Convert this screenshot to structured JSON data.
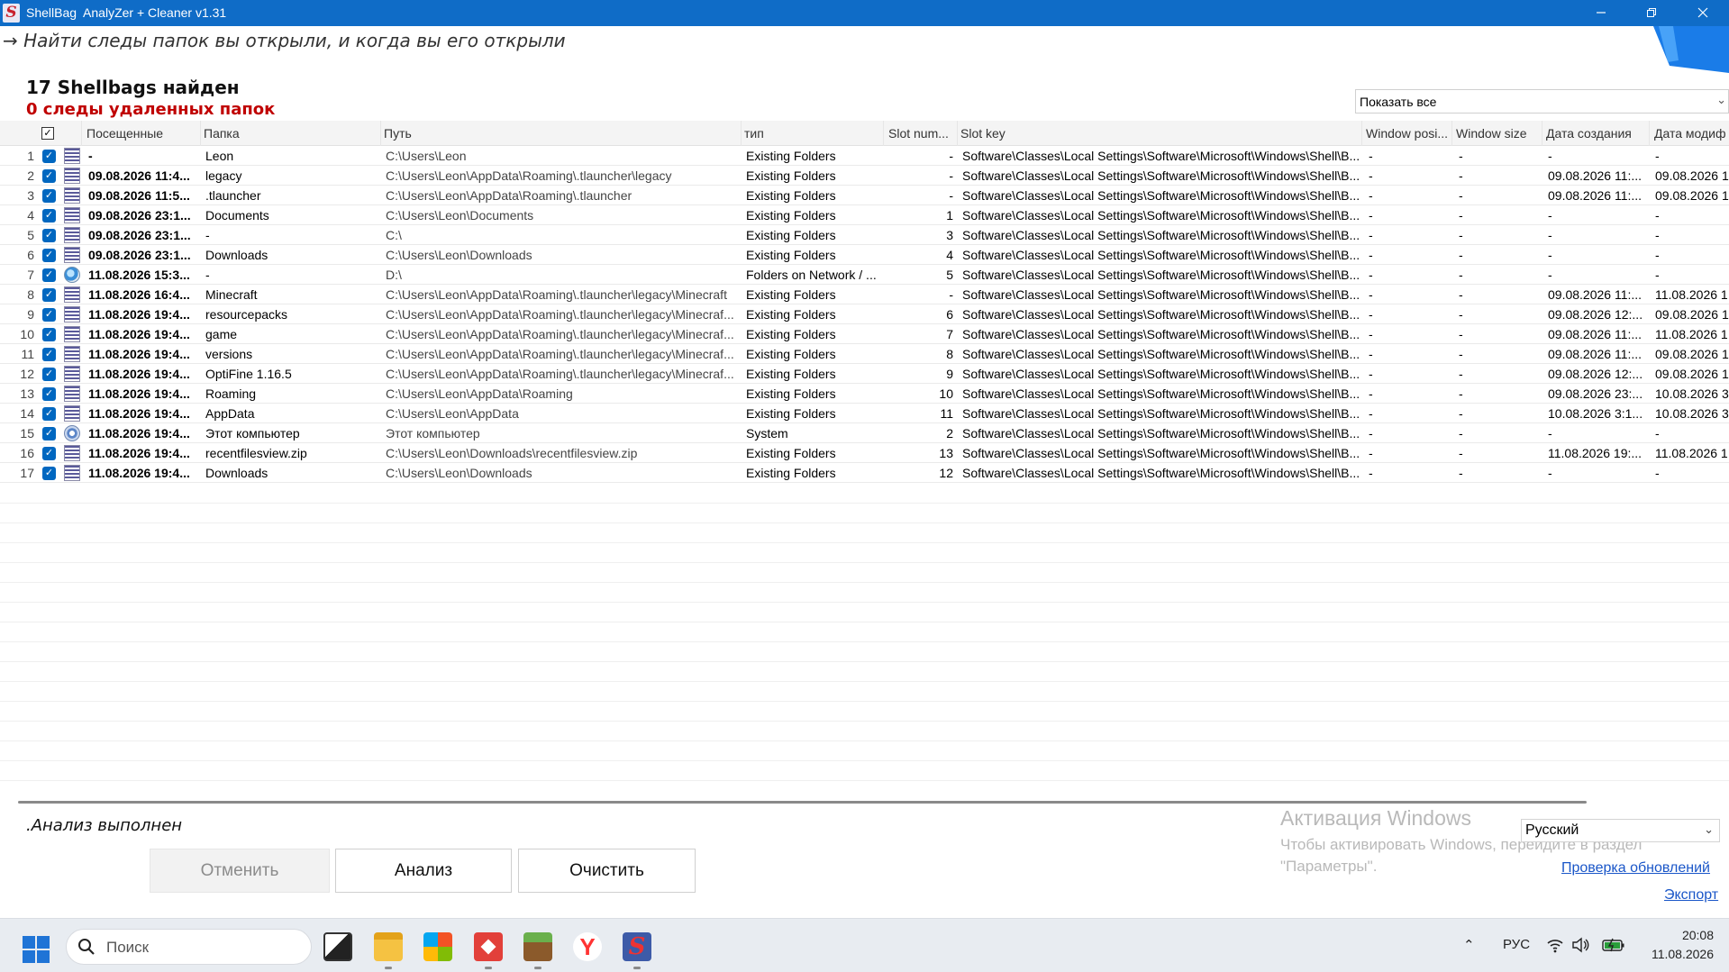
{
  "window": {
    "title": "ShellBag  AnalyZer + Cleaner v1.31",
    "icon_letter": "S",
    "minimize_icon": "minimize-icon",
    "maximize_icon": "restore-icon",
    "close_icon": "close-icon"
  },
  "tagline": "→ Найти следы папок вы открыли, и когда вы его открыли",
  "summary": {
    "found": "17 Shellbags найден",
    "deleted": "0  следы удаленных папок"
  },
  "filter": {
    "value": "Показать все"
  },
  "table": {
    "columns": [
      "Посещенные",
      "Папка",
      "Путь",
      "тип",
      "Slot num...",
      "Slot key",
      "Window posi...",
      "Window size",
      "Дата создания",
      "Дата модиф"
    ],
    "rows": [
      {
        "num": "1",
        "icon": "folder",
        "visited": "-",
        "folder": "Leon",
        "path": "C:\\Users\\Leon",
        "type": "Existing Folders",
        "slot": "-",
        "key": "Software\\Classes\\Local Settings\\Software\\Microsoft\\Windows\\Shell\\B...",
        "wp": "-",
        "ws": "-",
        "created": "-",
        "modified": "-"
      },
      {
        "num": "2",
        "icon": "folder",
        "visited": "09.08.2026 11:4...",
        "folder": "legacy",
        "path": "C:\\Users\\Leon\\AppData\\Roaming\\.tlauncher\\legacy",
        "type": "Existing Folders",
        "slot": "-",
        "key": "Software\\Classes\\Local Settings\\Software\\Microsoft\\Windows\\Shell\\B...",
        "wp": "-",
        "ws": "-",
        "created": "09.08.2026 11:...",
        "modified": "09.08.2026 1"
      },
      {
        "num": "3",
        "icon": "folder",
        "visited": "09.08.2026 11:5...",
        "folder": ".tlauncher",
        "path": "C:\\Users\\Leon\\AppData\\Roaming\\.tlauncher",
        "type": "Existing Folders",
        "slot": "-",
        "key": "Software\\Classes\\Local Settings\\Software\\Microsoft\\Windows\\Shell\\B...",
        "wp": "-",
        "ws": "-",
        "created": "09.08.2026 11:...",
        "modified": "09.08.2026 1"
      },
      {
        "num": "4",
        "icon": "folder",
        "visited": "09.08.2026 23:1...",
        "folder": "Documents",
        "path": "C:\\Users\\Leon\\Documents",
        "type": "Existing Folders",
        "slot": "1",
        "key": "Software\\Classes\\Local Settings\\Software\\Microsoft\\Windows\\Shell\\B...",
        "wp": "-",
        "ws": "-",
        "created": "-",
        "modified": "-"
      },
      {
        "num": "5",
        "icon": "folder",
        "visited": "09.08.2026 23:1...",
        "folder": "-",
        "path": "C:\\",
        "type": "Existing Folders",
        "slot": "3",
        "key": "Software\\Classes\\Local Settings\\Software\\Microsoft\\Windows\\Shell\\B...",
        "wp": "-",
        "ws": "-",
        "created": "-",
        "modified": "-"
      },
      {
        "num": "6",
        "icon": "folder",
        "visited": "09.08.2026 23:1...",
        "folder": "Downloads",
        "path": "C:\\Users\\Leon\\Downloads",
        "type": "Existing Folders",
        "slot": "4",
        "key": "Software\\Classes\\Local Settings\\Software\\Microsoft\\Windows\\Shell\\B...",
        "wp": "-",
        "ws": "-",
        "created": "-",
        "modified": "-"
      },
      {
        "num": "7",
        "icon": "network",
        "visited": "11.08.2026 15:3...",
        "folder": "-",
        "path": "D:\\",
        "type": "Folders on Network / ...",
        "slot": "5",
        "key": "Software\\Classes\\Local Settings\\Software\\Microsoft\\Windows\\Shell\\B...",
        "wp": "-",
        "ws": "-",
        "created": "-",
        "modified": "-"
      },
      {
        "num": "8",
        "icon": "folder",
        "visited": "11.08.2026 16:4...",
        "folder": "Minecraft",
        "path": "C:\\Users\\Leon\\AppData\\Roaming\\.tlauncher\\legacy\\Minecraft",
        "type": "Existing Folders",
        "slot": "-",
        "key": "Software\\Classes\\Local Settings\\Software\\Microsoft\\Windows\\Shell\\B...",
        "wp": "-",
        "ws": "-",
        "created": "09.08.2026 11:...",
        "modified": "11.08.2026 1"
      },
      {
        "num": "9",
        "icon": "folder",
        "visited": "11.08.2026 19:4...",
        "folder": "resourcepacks",
        "path": "C:\\Users\\Leon\\AppData\\Roaming\\.tlauncher\\legacy\\Minecraf...",
        "type": "Existing Folders",
        "slot": "6",
        "key": "Software\\Classes\\Local Settings\\Software\\Microsoft\\Windows\\Shell\\B...",
        "wp": "-",
        "ws": "-",
        "created": "09.08.2026 12:...",
        "modified": "09.08.2026 1"
      },
      {
        "num": "10",
        "icon": "folder",
        "visited": "11.08.2026 19:4...",
        "folder": "game",
        "path": "C:\\Users\\Leon\\AppData\\Roaming\\.tlauncher\\legacy\\Minecraf...",
        "type": "Existing Folders",
        "slot": "7",
        "key": "Software\\Classes\\Local Settings\\Software\\Microsoft\\Windows\\Shell\\B...",
        "wp": "-",
        "ws": "-",
        "created": "09.08.2026 11:...",
        "modified": "11.08.2026 1"
      },
      {
        "num": "11",
        "icon": "folder",
        "visited": "11.08.2026 19:4...",
        "folder": "versions",
        "path": "C:\\Users\\Leon\\AppData\\Roaming\\.tlauncher\\legacy\\Minecraf...",
        "type": "Existing Folders",
        "slot": "8",
        "key": "Software\\Classes\\Local Settings\\Software\\Microsoft\\Windows\\Shell\\B...",
        "wp": "-",
        "ws": "-",
        "created": "09.08.2026 11:...",
        "modified": "09.08.2026 1"
      },
      {
        "num": "12",
        "icon": "folder",
        "visited": "11.08.2026 19:4...",
        "folder": "OptiFine 1.16.5",
        "path": "C:\\Users\\Leon\\AppData\\Roaming\\.tlauncher\\legacy\\Minecraf...",
        "type": "Existing Folders",
        "slot": "9",
        "key": "Software\\Classes\\Local Settings\\Software\\Microsoft\\Windows\\Shell\\B...",
        "wp": "-",
        "ws": "-",
        "created": "09.08.2026 12:...",
        "modified": "09.08.2026 1"
      },
      {
        "num": "13",
        "icon": "folder",
        "visited": "11.08.2026 19:4...",
        "folder": "Roaming",
        "path": "C:\\Users\\Leon\\AppData\\Roaming",
        "type": "Existing Folders",
        "slot": "10",
        "key": "Software\\Classes\\Local Settings\\Software\\Microsoft\\Windows\\Shell\\B...",
        "wp": "-",
        "ws": "-",
        "created": "09.08.2026 23:...",
        "modified": "10.08.2026 3"
      },
      {
        "num": "14",
        "icon": "folder",
        "visited": "11.08.2026 19:4...",
        "folder": "AppData",
        "path": "C:\\Users\\Leon\\AppData",
        "type": "Existing Folders",
        "slot": "11",
        "key": "Software\\Classes\\Local Settings\\Software\\Microsoft\\Windows\\Shell\\B...",
        "wp": "-",
        "ws": "-",
        "created": "10.08.2026 3:1...",
        "modified": "10.08.2026 3"
      },
      {
        "num": "15",
        "icon": "system",
        "visited": "11.08.2026 19:4...",
        "folder": "Этот компьютер",
        "path": "Этот компьютер",
        "type": "System",
        "slot": "2",
        "key": "Software\\Classes\\Local Settings\\Software\\Microsoft\\Windows\\Shell\\B...",
        "wp": "-",
        "ws": "-",
        "created": "-",
        "modified": "-"
      },
      {
        "num": "16",
        "icon": "folder",
        "visited": "11.08.2026 19:4...",
        "folder": "recentfilesview.zip",
        "path": "C:\\Users\\Leon\\Downloads\\recentfilesview.zip",
        "type": "Existing Folders",
        "slot": "13",
        "key": "Software\\Classes\\Local Settings\\Software\\Microsoft\\Windows\\Shell\\B...",
        "wp": "-",
        "ws": "-",
        "created": "11.08.2026 19:...",
        "modified": "11.08.2026 1"
      },
      {
        "num": "17",
        "icon": "folder",
        "visited": "11.08.2026 19:4...",
        "folder": "Downloads",
        "path": "C:\\Users\\Leon\\Downloads",
        "type": "Existing Folders",
        "slot": "12",
        "key": "Software\\Classes\\Local Settings\\Software\\Microsoft\\Windows\\Shell\\B...",
        "wp": "-",
        "ws": "-",
        "created": "-",
        "modified": "-"
      }
    ]
  },
  "status": ".Анализ выполнен",
  "buttons": {
    "cancel": "Отменить",
    "analyze": "Анализ",
    "clean": "Очистить"
  },
  "activation": {
    "title": "Активация Windows",
    "text": "Чтобы активировать Windows, перейдите в раздел \"Параметры\"."
  },
  "language": {
    "value": "Русский"
  },
  "links": {
    "check_updates": "Проверка обновлений",
    "export": "Экспорт"
  },
  "taskbar": {
    "search_placeholder": "Поиск",
    "input_lang": "РУС",
    "time": "20:08",
    "date": "11.08.2026"
  },
  "colors": {
    "titlebar": "#0f6cc7",
    "deleted": "#c00000",
    "link": "#1a56c8",
    "checkbox": "#0067c0"
  }
}
